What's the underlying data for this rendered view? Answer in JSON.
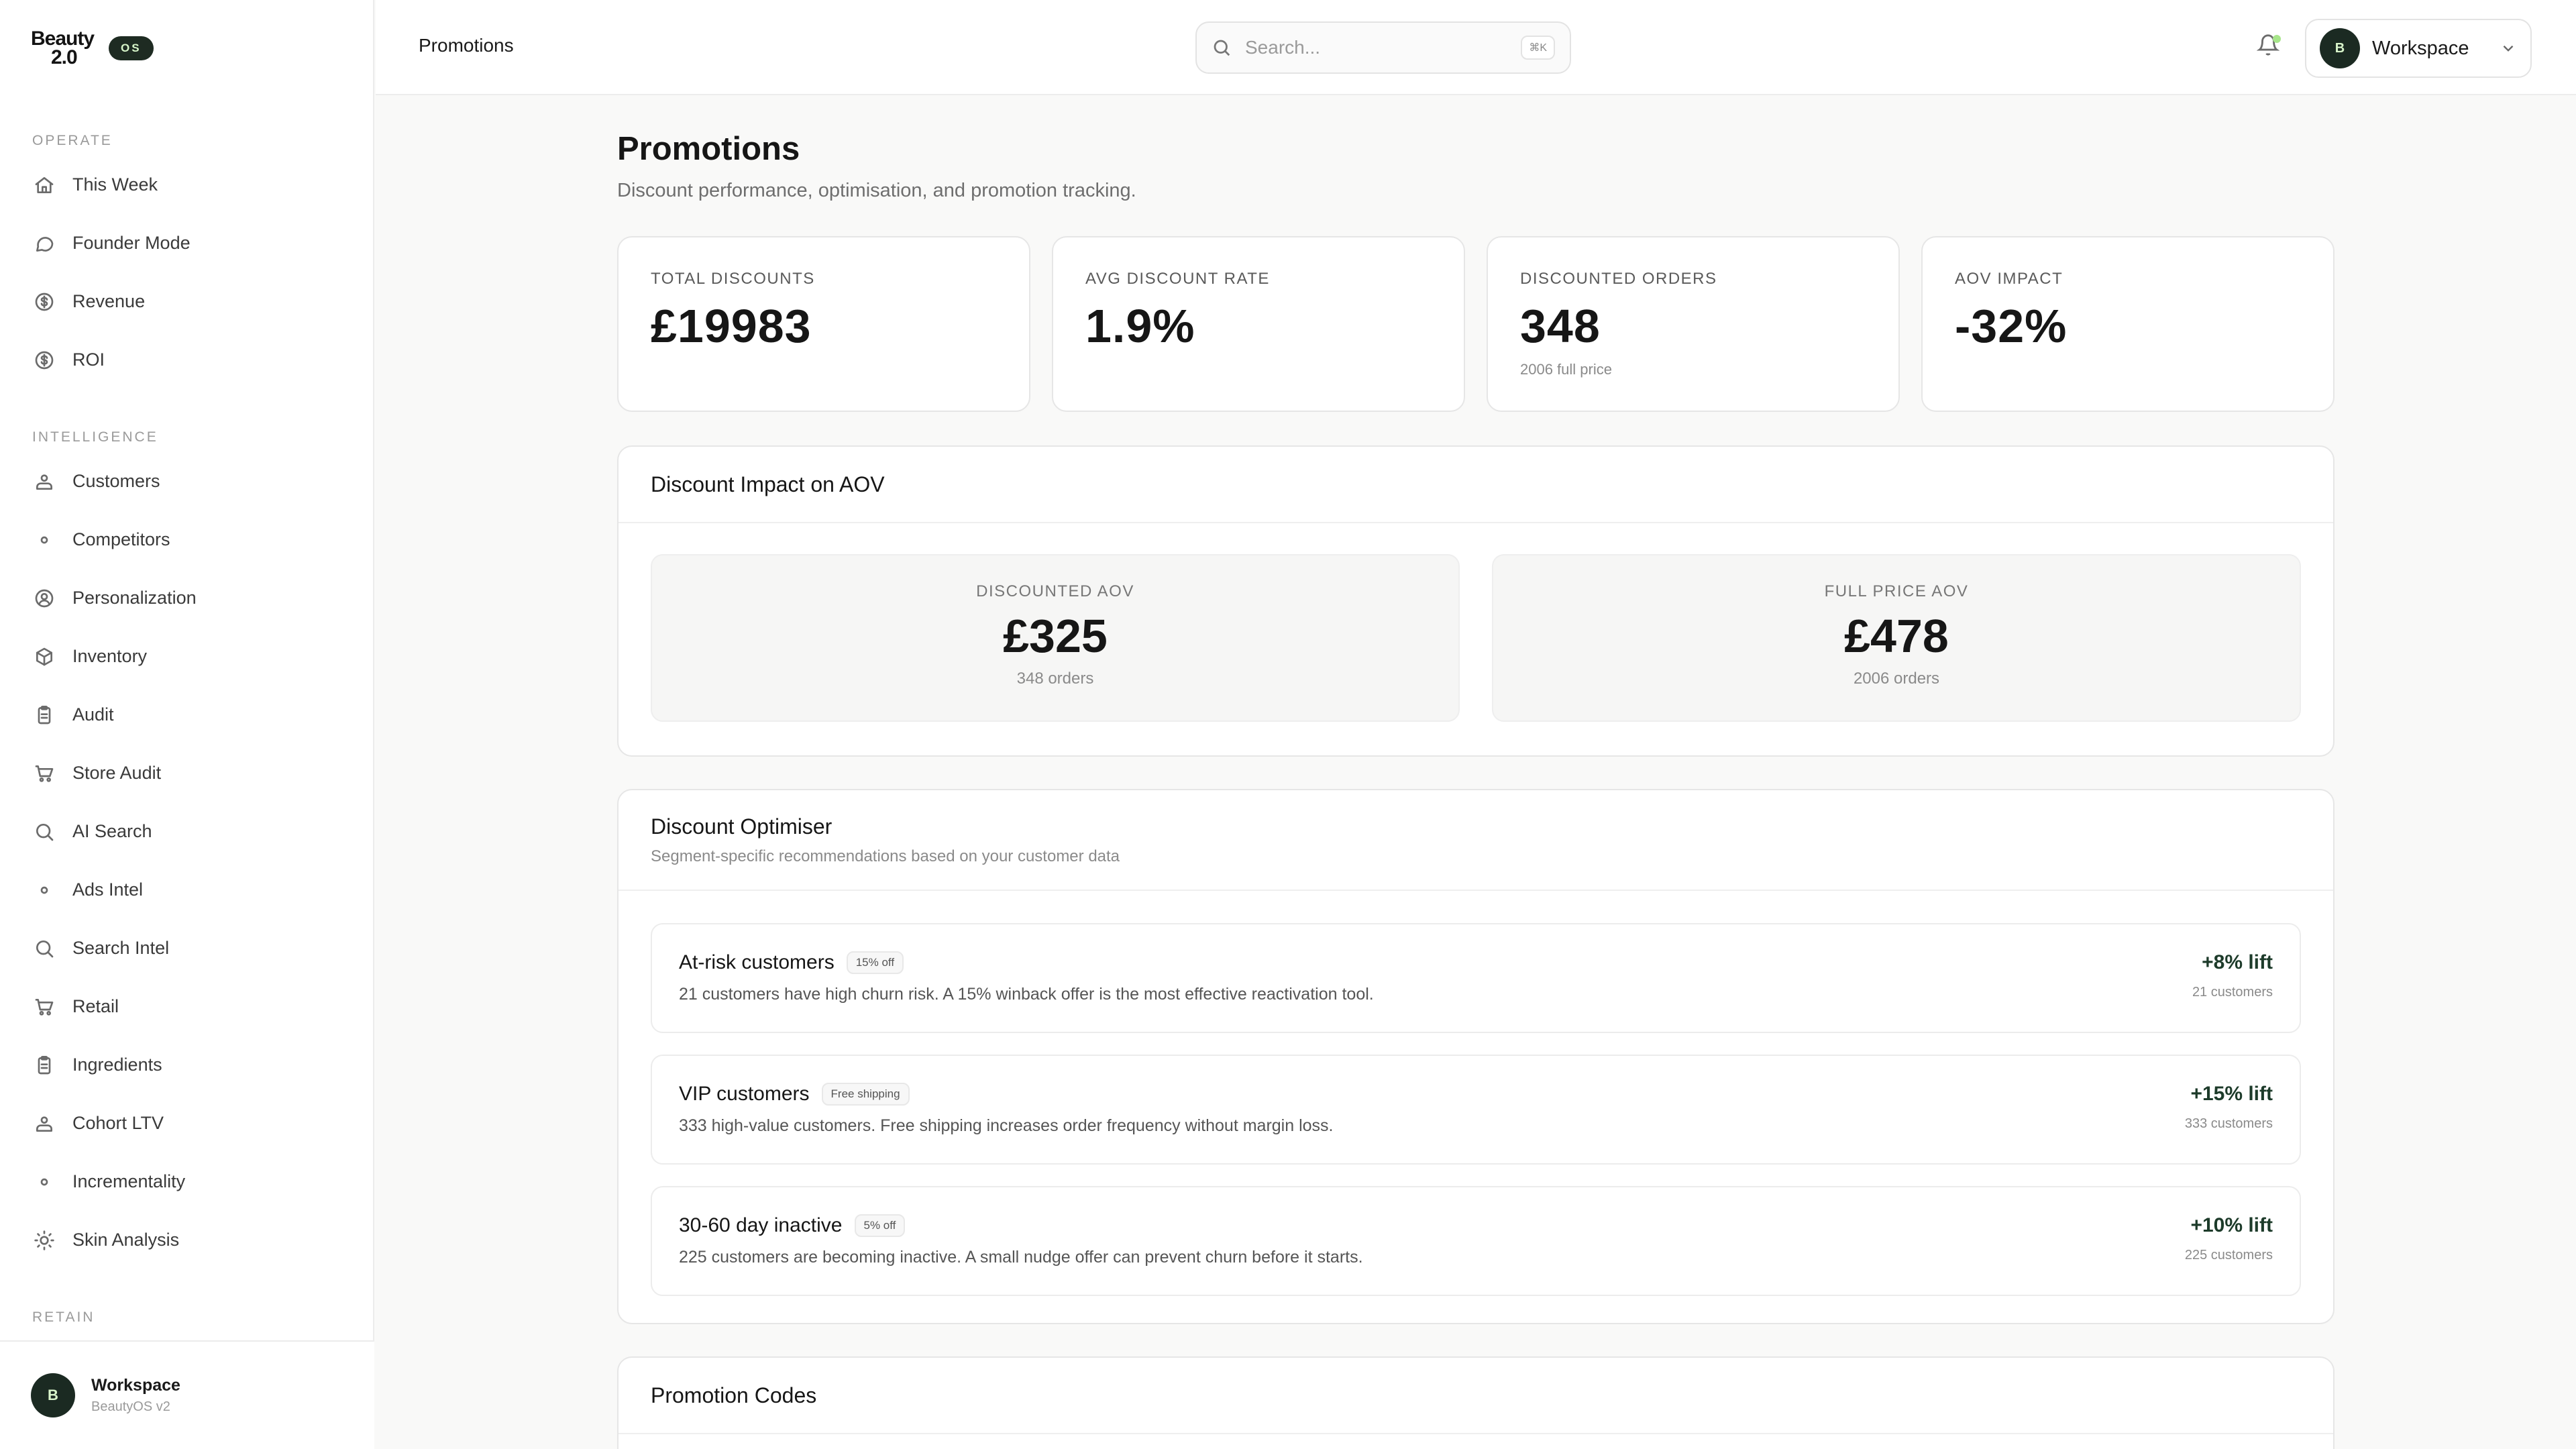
{
  "brand": {
    "logo_line1": "Beauty",
    "logo_line2": "2.0",
    "badge": "OS"
  },
  "sidebar": {
    "sections": [
      {
        "label": "OPERATE",
        "items": [
          {
            "label": "This Week",
            "icon": "home-icon"
          },
          {
            "label": "Founder Mode",
            "icon": "chat-icon"
          },
          {
            "label": "Revenue",
            "icon": "dollar-icon"
          },
          {
            "label": "ROI",
            "icon": "dollar-icon"
          }
        ]
      },
      {
        "label": "INTELLIGENCE",
        "items": [
          {
            "label": "Customers",
            "icon": "users-icon"
          },
          {
            "label": "Competitors",
            "icon": "dot-icon"
          },
          {
            "label": "Personalization",
            "icon": "user-circle-icon"
          },
          {
            "label": "Inventory",
            "icon": "box-icon"
          },
          {
            "label": "Audit",
            "icon": "clipboard-icon"
          },
          {
            "label": "Store Audit",
            "icon": "cart-icon"
          },
          {
            "label": "AI Search",
            "icon": "search-icon"
          },
          {
            "label": "Ads Intel",
            "icon": "dot-icon"
          },
          {
            "label": "Search Intel",
            "icon": "search-icon"
          },
          {
            "label": "Retail",
            "icon": "cart-icon"
          },
          {
            "label": "Ingredients",
            "icon": "clipboard-icon"
          },
          {
            "label": "Cohort LTV",
            "icon": "users-icon"
          },
          {
            "label": "Incrementality",
            "icon": "dot-icon"
          },
          {
            "label": "Skin Analysis",
            "icon": "sun-icon"
          }
        ]
      },
      {
        "label": "RETAIN",
        "items": []
      }
    ],
    "footer": {
      "avatar_initial": "B",
      "name": "Workspace",
      "sub": "BeautyOS v2"
    }
  },
  "topbar": {
    "breadcrumb": "Promotions",
    "search_placeholder": "Search...",
    "search_shortcut": "⌘K",
    "workspace_initial": "B",
    "workspace_name": "Workspace"
  },
  "page": {
    "title": "Promotions",
    "subtitle": "Discount performance, optimisation, and promotion tracking."
  },
  "kpis": [
    {
      "label": "TOTAL DISCOUNTS",
      "value": "£19983",
      "note": ""
    },
    {
      "label": "AVG DISCOUNT RATE",
      "value": "1.9%",
      "note": ""
    },
    {
      "label": "DISCOUNTED ORDERS",
      "value": "348",
      "note": "2006 full price"
    },
    {
      "label": "AOV IMPACT",
      "value": "-32%",
      "note": ""
    }
  ],
  "aov_panel": {
    "title": "Discount Impact on AOV",
    "discounted": {
      "label": "DISCOUNTED AOV",
      "value": "£325",
      "note": "348 orders"
    },
    "full_price": {
      "label": "FULL PRICE AOV",
      "value": "£478",
      "note": "2006 orders"
    }
  },
  "optimiser": {
    "title": "Discount Optimiser",
    "subtitle": "Segment-specific recommendations based on your customer data",
    "recommendations": [
      {
        "segment": "At-risk customers",
        "tag": "15% off",
        "description": "21 customers have high churn risk. A 15% winback offer is the most effective reactivation tool.",
        "lift": "+8% lift",
        "customers": "21 customers"
      },
      {
        "segment": "VIP customers",
        "tag": "Free shipping",
        "description": "333 high-value customers. Free shipping increases order frequency without margin loss.",
        "lift": "+15% lift",
        "customers": "333 customers"
      },
      {
        "segment": "30-60 day inactive",
        "tag": "5% off",
        "description": "225 customers are becoming inactive. A small nudge offer can prevent churn before it starts.",
        "lift": "+10% lift",
        "customers": "225 customers"
      }
    ]
  },
  "promo_codes": {
    "title": "Promotion Codes"
  },
  "colors": {
    "accent_dark": "#1b2a22",
    "accent_light": "#d9f5cb",
    "notification": "#a7e58a",
    "lift_text": "#1d3b2a"
  }
}
